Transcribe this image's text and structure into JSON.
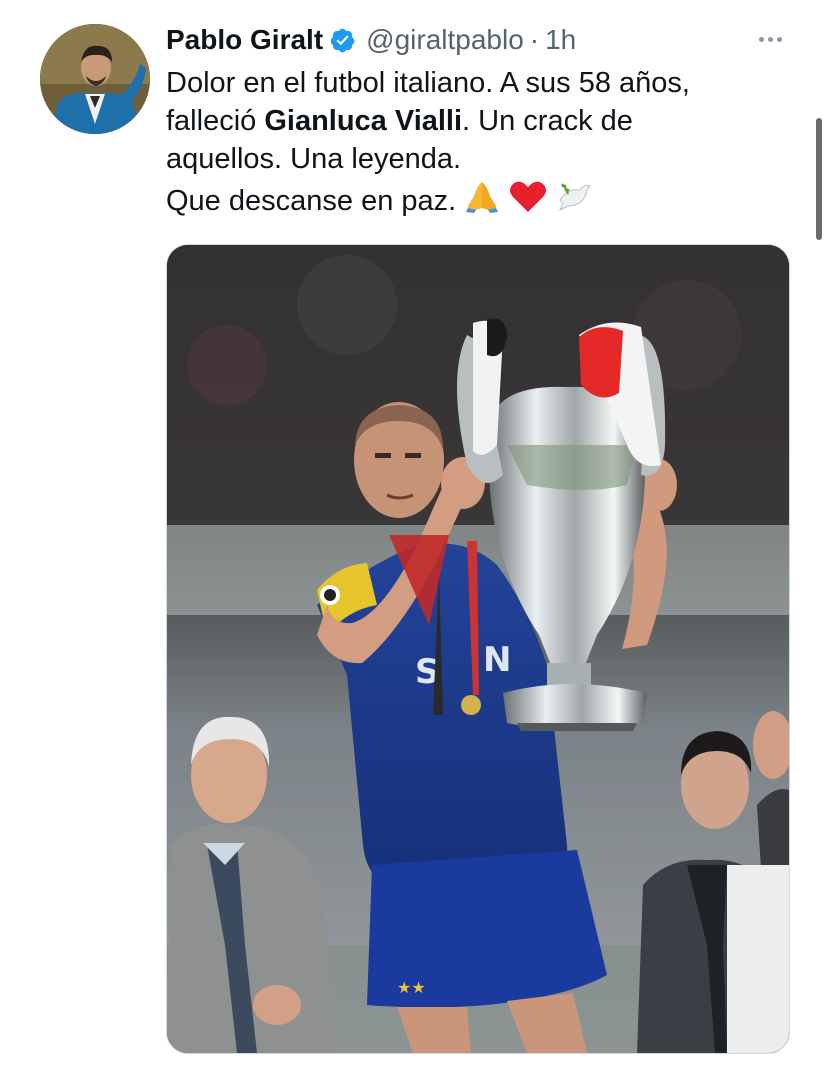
{
  "tweet": {
    "author": {
      "display_name": "Pablo Giralt",
      "handle": "@giraltpablo",
      "verified": true,
      "avatar_icon": "avatar-photo"
    },
    "separator": "·",
    "time": "1h",
    "text": {
      "line1": "Dolor en el futbol italiano. A sus 58 años,",
      "line2_before": "falleció ",
      "line2_bold": "Gianluca Vialli",
      "line2_after": ". Un crack de",
      "line3": "aquellos. Una leyenda.",
      "line4": "Que descanse en paz.",
      "emojis": [
        "folded-hands-emoji",
        "red-heart-emoji",
        "dove-emoji"
      ]
    },
    "media": {
      "type": "photo",
      "icon": "footballer-holding-trophy-photo"
    }
  },
  "colors": {
    "verified_badge": "#1d9bf0",
    "secondary_text": "#536471",
    "primary_text": "#0f1419",
    "jersey_blue": "#1c3b8c"
  },
  "icons": {
    "verified": "verified-badge-icon",
    "more": "more-options-icon"
  }
}
